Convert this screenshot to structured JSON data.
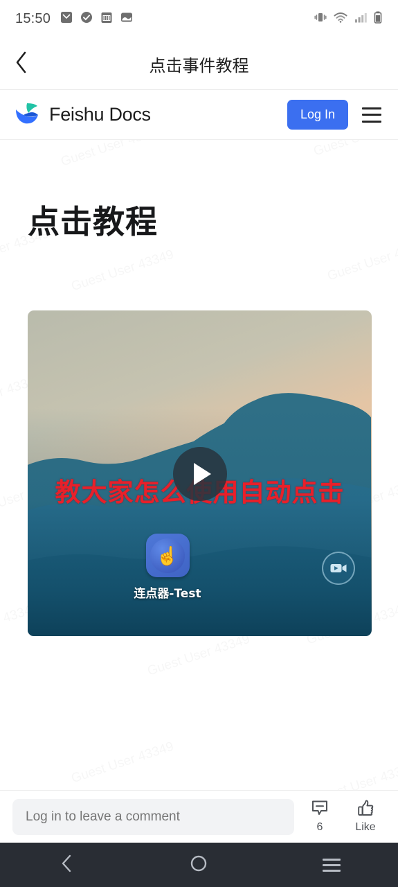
{
  "status_bar": {
    "time": "15:50",
    "left_icons": [
      "mail-icon",
      "check-circle-icon",
      "calendar-icon",
      "photo-icon"
    ],
    "right_icons": [
      "vibrate-icon",
      "wifi-icon",
      "signal-icon",
      "battery-icon"
    ]
  },
  "app_bar": {
    "back_icon": "chevron-left-icon",
    "title": "点击事件教程"
  },
  "site_header": {
    "logo_icon": "feishu-logo-icon",
    "brand_name": "Feishu Docs",
    "login_label": "Log In",
    "menu_icon": "hamburger-menu-icon"
  },
  "watermark": {
    "text": "Guest User 43349"
  },
  "document": {
    "title": "点击教程",
    "video": {
      "caption_text": "教大家怎么使用自动点击",
      "play_icon": "play-icon",
      "badge_icon": "video-camera-icon",
      "app_shortcut": {
        "icon": "click-app-icon",
        "glyph": "☝",
        "label": "连点器-Test"
      }
    }
  },
  "comment_bar": {
    "placeholder": "Log in to leave a comment",
    "comment_icon": "comment-bubble-icon",
    "comment_count": "6",
    "like_icon": "thumbs-up-icon",
    "like_label": "Like"
  },
  "nav_bar": {
    "back_icon": "nav-back-icon",
    "home_icon": "nav-home-icon",
    "recents_icon": "nav-recents-icon"
  },
  "colors": {
    "accent_blue": "#3b6ff0",
    "caption_red": "#e8202a",
    "navbar_dark": "#292d34"
  }
}
